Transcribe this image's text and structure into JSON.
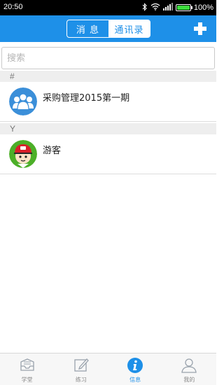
{
  "status_bar": {
    "time": "20:50",
    "battery": "100%",
    "battery_level": 1.0
  },
  "header": {
    "tabs": [
      {
        "label": "消 息",
        "active": false
      },
      {
        "label": "通讯录",
        "active": true
      }
    ],
    "add_icon": "plus-icon"
  },
  "search": {
    "placeholder": "搜索",
    "value": ""
  },
  "sections": [
    {
      "letter": "#",
      "contacts": [
        {
          "name": "采购管理2015第一期",
          "avatar": "group-avatar-icon"
        }
      ]
    },
    {
      "letter": "Y",
      "contacts": [
        {
          "name": "游客",
          "avatar": "cartoon-user-avatar"
        }
      ]
    }
  ],
  "bottom_nav": {
    "items": [
      {
        "label": "学堂",
        "icon": "study-hall-icon",
        "active": false
      },
      {
        "label": "练习",
        "icon": "practice-edit-icon",
        "active": false
      },
      {
        "label": "信息",
        "icon": "info-icon",
        "active": true
      },
      {
        "label": "我的",
        "icon": "profile-icon",
        "active": false
      }
    ]
  },
  "colors": {
    "accent": "#1e90e8",
    "header_bg": "#1e90e8",
    "section_bg": "#eeeeee",
    "nav_inactive": "#8a8a8a",
    "nav_active": "#1e90e8"
  }
}
